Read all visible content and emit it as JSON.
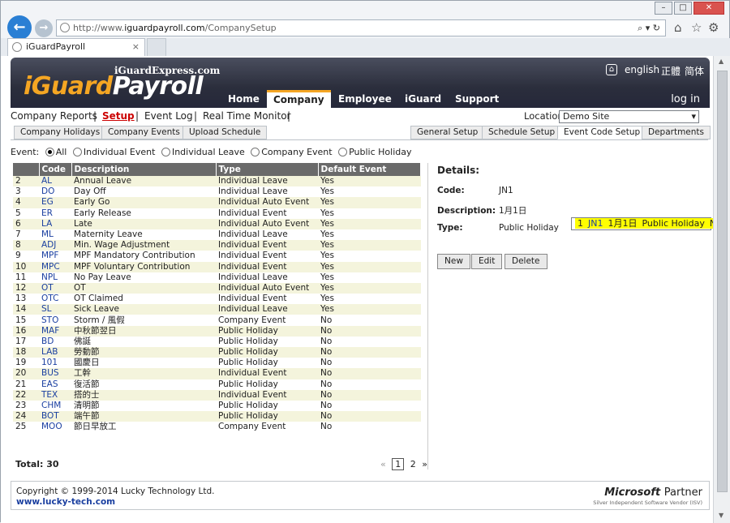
{
  "browser": {
    "url_prefix": "http://www.",
    "url_domain": "iguardpayroll.com",
    "url_path": "/CompanySetup",
    "tab_title": "iGuardPayroll"
  },
  "banner": {
    "brand_sub": "iGuardExpress.com",
    "logo_part1": "iGuard",
    "logo_part2": "Payroll",
    "menu": [
      "Home",
      "Company",
      "Employee",
      "iGuard",
      "Support"
    ],
    "active_menu": "Company",
    "lang_en": "english",
    "lang_tc": "正體",
    "lang_sc": "简体",
    "login": "log in"
  },
  "subnav": {
    "items": [
      "Company Reports",
      "Setup",
      "Event Log",
      "Real Time Monitor"
    ],
    "sep": "|",
    "location_label": "Location:",
    "location_value": "Demo Site"
  },
  "page_tabs_left": [
    "Company Holidays",
    "Company Events",
    "Upload Schedule"
  ],
  "page_tabs_right": [
    "General Setup",
    "Schedule Setup",
    "Event Code Setup",
    "Departments"
  ],
  "active_tab": "Event Code Setup",
  "filter": {
    "label": "Event:",
    "options": [
      "All",
      "Individual Event",
      "Individual Leave",
      "Company Event",
      "Public Holiday"
    ],
    "selected": "All"
  },
  "table": {
    "headers": [
      "",
      "Code",
      "Description",
      "Type",
      "Default Event"
    ],
    "rows": [
      [
        "1",
        "JN1",
        "1月1日",
        "Public Holiday",
        "No"
      ],
      [
        "2",
        "AL",
        "Annual Leave",
        "Individual Leave",
        "Yes"
      ],
      [
        "3",
        "DO",
        "Day Off",
        "Individual Leave",
        "Yes"
      ],
      [
        "4",
        "EG",
        "Early Go",
        "Individual Auto Event",
        "Yes"
      ],
      [
        "5",
        "ER",
        "Early Release",
        "Individual Event",
        "Yes"
      ],
      [
        "6",
        "LA",
        "Late",
        "Individual Auto Event",
        "Yes"
      ],
      [
        "7",
        "ML",
        "Maternity Leave",
        "Individual Leave",
        "Yes"
      ],
      [
        "8",
        "ADJ",
        "Min. Wage Adjustment",
        "Individual Event",
        "Yes"
      ],
      [
        "9",
        "MPF",
        "MPF Mandatory Contribution",
        "Individual Event",
        "Yes"
      ],
      [
        "10",
        "MPC",
        "MPF Voluntary Contribution",
        "Individual Event",
        "Yes"
      ],
      [
        "11",
        "NPL",
        "No Pay Leave",
        "Individual Leave",
        "Yes"
      ],
      [
        "12",
        "OT",
        "OT",
        "Individual Auto Event",
        "Yes"
      ],
      [
        "13",
        "OTC",
        "OT Claimed",
        "Individual Event",
        "Yes"
      ],
      [
        "14",
        "SL",
        "Sick Leave",
        "Individual Leave",
        "Yes"
      ],
      [
        "15",
        "STO",
        "Storm / 風假",
        "Company Event",
        "No"
      ],
      [
        "16",
        "MAF",
        "中秋節翌日",
        "Public Holiday",
        "No"
      ],
      [
        "17",
        "BD",
        "佛誕",
        "Public Holiday",
        "No"
      ],
      [
        "18",
        "LAB",
        "勞動節",
        "Public Holiday",
        "No"
      ],
      [
        "19",
        "101",
        "國慶日",
        "Public Holiday",
        "No"
      ],
      [
        "20",
        "BUS",
        "工幹",
        "Individual Event",
        "No"
      ],
      [
        "21",
        "EAS",
        "復活節",
        "Public Holiday",
        "No"
      ],
      [
        "22",
        "TEX",
        "搭的士",
        "Individual Event",
        "No"
      ],
      [
        "23",
        "CHM",
        "清明節",
        "Public Holiday",
        "No"
      ],
      [
        "24",
        "BOT",
        "端午節",
        "Public Holiday",
        "No"
      ],
      [
        "25",
        "MOO",
        "節日早放工",
        "Company Event",
        "No"
      ]
    ]
  },
  "total": "Total: 30",
  "pager": {
    "prev": "«",
    "pages": [
      "1",
      "2"
    ],
    "next": "»",
    "current": "1"
  },
  "details": {
    "title": "Details:",
    "code_label": "Code:",
    "code_value": "JN1",
    "desc_label": "Description:",
    "desc_value": "1月1日",
    "type_label": "Type:",
    "type_value": "Public Holiday",
    "buttons": [
      "New",
      "Edit",
      "Delete"
    ]
  },
  "footer": {
    "copyright": "Copyright © 1999-2014 Lucky Technology Ltd.",
    "site": "www.lucky-tech.com",
    "ms_brand": "Microsoft",
    "ms_partner": "Partner",
    "ms_sub": "Silver Independent Software Vendor (ISV)"
  }
}
